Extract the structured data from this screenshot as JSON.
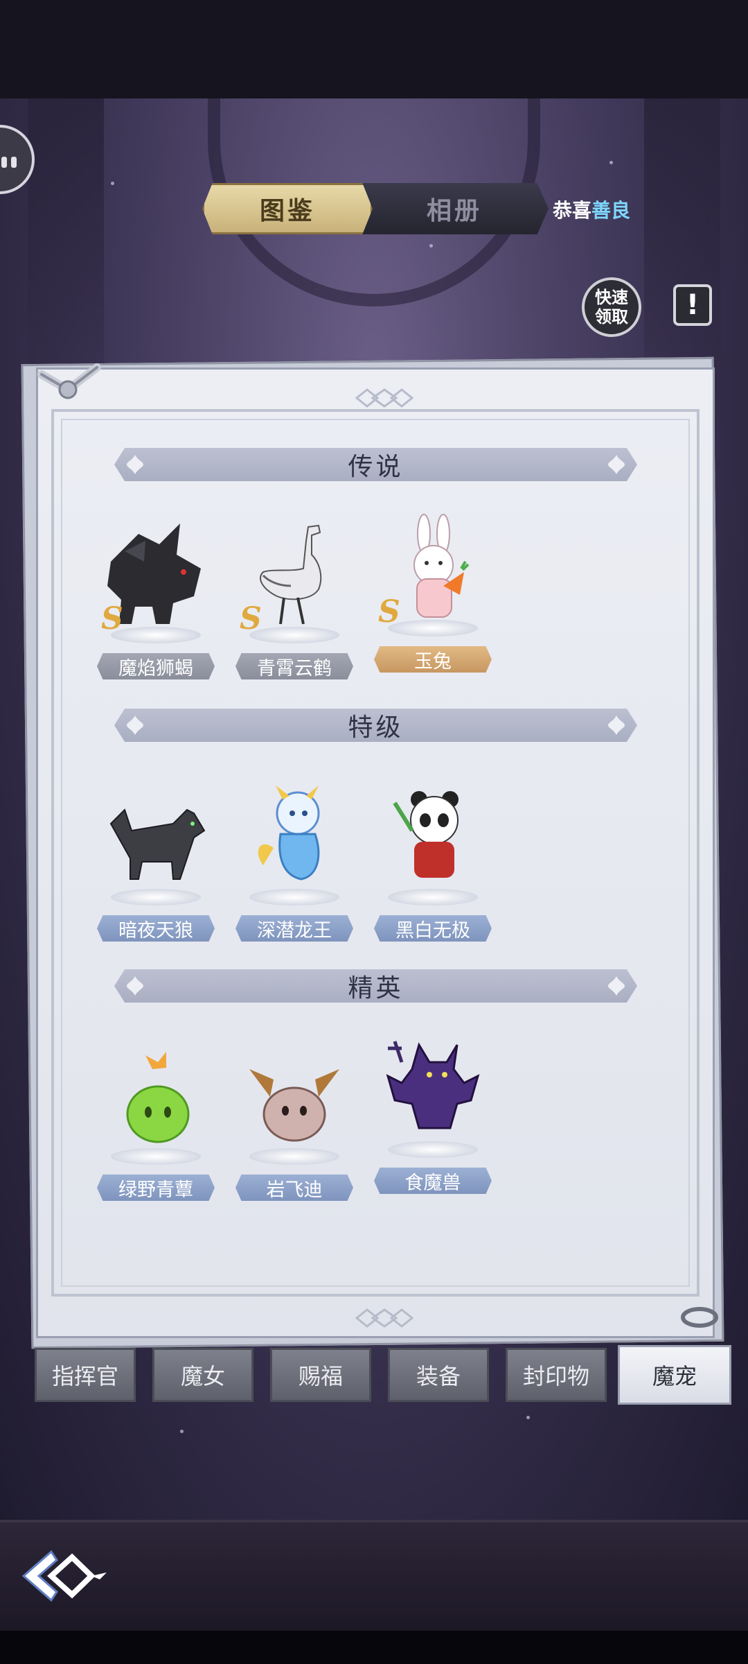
{
  "tabs": {
    "active": "图鉴",
    "inactive": "相册"
  },
  "congrats": {
    "prefix": "恭喜",
    "name": "善良"
  },
  "quick_claim": {
    "line1": "快速",
    "line2": "领取"
  },
  "info_label": "!",
  "sections": [
    {
      "title": "传说",
      "pets": [
        {
          "name": "魔焰狮蝎",
          "badge": "S",
          "label_style": "gray",
          "icon": "shadow-beast-icon"
        },
        {
          "name": "青霄云鹤",
          "badge": "S",
          "label_style": "gray",
          "icon": "crane-icon"
        },
        {
          "name": "玉兔",
          "badge": "S",
          "label_style": "gold",
          "icon": "rabbit-icon"
        }
      ]
    },
    {
      "title": "特级",
      "pets": [
        {
          "name": "暗夜天狼",
          "label_style": "blue",
          "icon": "wolf-icon"
        },
        {
          "name": "深潜龙王",
          "label_style": "blue",
          "icon": "dragon-icon"
        },
        {
          "name": "黑白无极",
          "label_style": "blue",
          "icon": "panda-icon"
        }
      ]
    },
    {
      "title": "精英",
      "pets": [
        {
          "name": "绿野青蕈",
          "label_style": "blue",
          "icon": "green-slime-icon"
        },
        {
          "name": "岩飞迪",
          "label_style": "blue",
          "icon": "bat-slime-icon"
        },
        {
          "name": "食魔兽",
          "label_style": "blue",
          "icon": "demon-icon"
        }
      ]
    }
  ],
  "bottom_tabs": [
    "指挥官",
    "魔女",
    "赐福",
    "装备",
    "封印物",
    "魔宠"
  ],
  "active_bottom_tab": "魔宠",
  "colors": {
    "gold_tab": "#e7d9a8",
    "label_gold": "#e2b984",
    "label_blue": "#9cb0d4",
    "label_gray": "#a4a7b3"
  }
}
